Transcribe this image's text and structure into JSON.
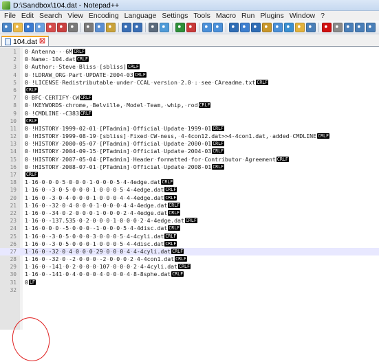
{
  "window": {
    "title": "D:\\Sandbox\\104.dat - Notepad++"
  },
  "menu": [
    "File",
    "Edit",
    "Search",
    "View",
    "Encoding",
    "Language",
    "Settings",
    "Tools",
    "Macro",
    "Run",
    "Plugins",
    "Window",
    "?"
  ],
  "tabs": [
    {
      "label": "104.dat",
      "close": "☒"
    }
  ],
  "toolbar_icons": [
    "new-file-icon",
    "open-file-icon",
    "save-icon",
    "save-all-icon",
    "close-icon",
    "close-all-icon",
    "print-icon",
    "sep",
    "cut-icon",
    "copy-icon",
    "paste-icon",
    "sep",
    "undo-icon",
    "redo-icon",
    "sep",
    "find-icon",
    "replace-icon",
    "sep",
    "zoom-in-icon",
    "zoom-out-icon",
    "sep",
    "sync-v-icon",
    "sync-h-icon",
    "sep",
    "wrap-icon",
    "all-chars-icon",
    "indent-guide-icon",
    "user-lang-icon",
    "doc-map-icon",
    "func-list-icon",
    "folder-icon",
    "monitor-icon",
    "sep",
    "record-macro-icon",
    "stop-macro-icon",
    "play-macro-icon",
    "play-multiple-icon",
    "save-macro-icon"
  ],
  "editor": {
    "current_line": 27,
    "lines": [
      {
        "n": "1",
        "text": "0 Antenna - 6M",
        "eol": "CRLF"
      },
      {
        "n": "2",
        "text": "0 Name: 104.dat",
        "eol": "CRLF"
      },
      {
        "n": "3",
        "text": "0 Author: Steve Bliss [sbliss]",
        "eol": "CRLF"
      },
      {
        "n": "4",
        "text": "0 !LDRAW_ORG Part UPDATE 2004-03",
        "eol": "CRLF"
      },
      {
        "n": "5",
        "text": "0 !LICENSE Redistributable under CCAL version 2.0 : see CAreadme.txt",
        "eol": "CRLF"
      },
      {
        "n": "6",
        "text": "",
        "eol": "CRLF"
      },
      {
        "n": "7",
        "text": "0 BFC CERTIFY CW",
        "eol": "CRLF"
      },
      {
        "n": "8",
        "text": "0 !KEYWORDS chrome, Belville, Model Team, whip, rod",
        "eol": "CRLF"
      },
      {
        "n": "9",
        "text": "0 !CMDLINE -C383",
        "eol": "CRLF"
      },
      {
        "n": "10",
        "text": "",
        "eol": "CRLF"
      },
      {
        "n": "11",
        "text": "0 !HISTORY 1999-02-01 [PTadmin] Official Update 1999-01",
        "eol": "CRLF"
      },
      {
        "n": "12",
        "text": "0 !HISTORY 1999-08-19 [sbliss] Fixed CW-ness, 4-4con12.dat>>4-4con1.dat, added CMDLINE",
        "eol": "CRLF"
      },
      {
        "n": "13",
        "text": "0 !HISTORY 2000-05-07 [PTadmin] Official Update 2000-01",
        "eol": "CRLF"
      },
      {
        "n": "14",
        "text": "0 !HISTORY 2004-09-15 [PTadmin] Official Update 2004-03",
        "eol": "CRLF"
      },
      {
        "n": "15",
        "text": "0 !HISTORY 2007-05-04 [PTadmin] Header formatted for Contributor Agreement",
        "eol": "CRLF"
      },
      {
        "n": "16",
        "text": "0 !HISTORY 2008-07-01 [PTadmin] Official Update 2008-01",
        "eol": "CRLF"
      },
      {
        "n": "17",
        "text": "",
        "eol": "CRLF"
      },
      {
        "n": "18",
        "text": "1 16 0 0 0 5 0 0 0 1 0 0 0 5 4-4edge.dat",
        "eol": "CRLF"
      },
      {
        "n": "19",
        "text": "1 16 0 -3 0 5 0 0 0 1 0 0 0 5 4-4edge.dat",
        "eol": "CRLF"
      },
      {
        "n": "20",
        "text": "1 16 0 -3 0 4 0 0 0 1 0 0 0 4 4-4edge.dat",
        "eol": "CRLF"
      },
      {
        "n": "21",
        "text": "1 16 0 -32 0 4 0 0 0 1 0 0 0 4 4-4edge.dat",
        "eol": "CRLF"
      },
      {
        "n": "22",
        "text": "1 16 0 -34 0 2 0 0 0 1 0 0 0 2 4-4edge.dat",
        "eol": "CRLF"
      },
      {
        "n": "23",
        "text": "1 16 0 -137.535 0 2 0 0 0 1 0 0 0 2 4-4edge.dat",
        "eol": "CRLF"
      },
      {
        "n": "24",
        "text": "1 16 0 0 0 -5 0 0 0 -1 0 0 0 5 4-4disc.dat",
        "eol": "CRLF"
      },
      {
        "n": "25",
        "text": "1 16 0 -3 0 5 0 0 0 3 0 0 0 5 4-4cyli.dat",
        "eol": "CRLF"
      },
      {
        "n": "26",
        "text": "1 16 0 -3 0 5 0 0 0 1 0 0 0 5 4-4disc.dat",
        "eol": "CRLF"
      },
      {
        "n": "27",
        "text": "1 16 0 -32 0 4 0 0 0 29 0 0 0 4 4-4cyli.dat",
        "eol": "CRLF"
      },
      {
        "n": "28",
        "text": "1 16 0 -32 0 -2 0 0 0 -2 0 0 0 2 4-4con1.dat",
        "eol": "CRLF"
      },
      {
        "n": "29",
        "text": "1 16 0 -141 0 2 0 0 0 107 0 0 0 2 4-4cyli.dat",
        "eol": "CRLF"
      },
      {
        "n": "30",
        "text": "1 16 0 -141 0 4 0 0 0 4 0 0 0 4 8-8sphe.dat",
        "eol": "CRLF"
      },
      {
        "n": "31",
        "text": "0",
        "eol": "LF"
      },
      {
        "n": "32",
        "text": "",
        "eol": ""
      }
    ]
  }
}
